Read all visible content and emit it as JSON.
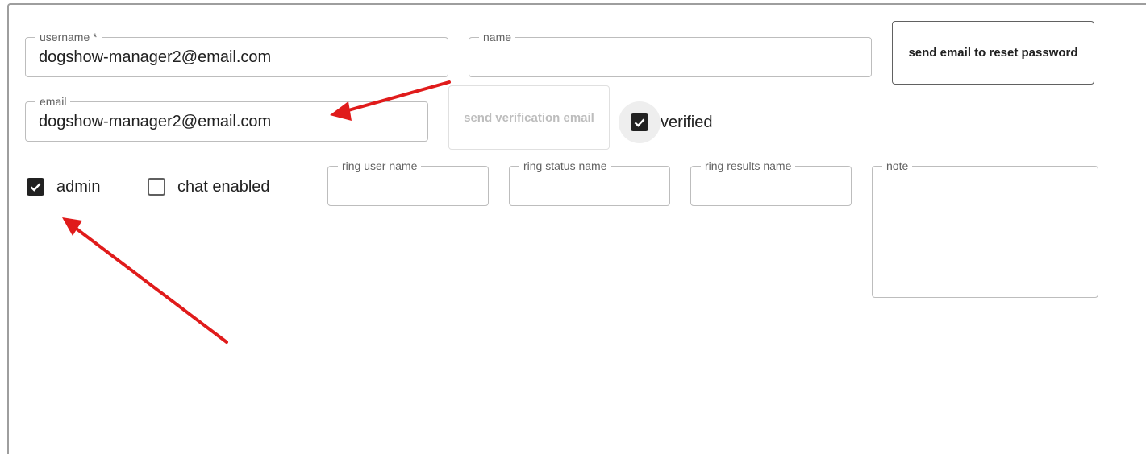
{
  "form": {
    "username": {
      "label": "username *",
      "value": "dogshow-manager2@email.com"
    },
    "name": {
      "label": "name",
      "value": ""
    },
    "email": {
      "label": "email",
      "value": "dogshow-manager2@email.com"
    },
    "ring_user_name": {
      "label": "ring user name",
      "value": ""
    },
    "ring_status_name": {
      "label": "ring status name",
      "value": ""
    },
    "ring_results_name": {
      "label": "ring results name",
      "value": ""
    },
    "note": {
      "label": "note",
      "value": ""
    }
  },
  "buttons": {
    "reset_password": "send email to reset password",
    "send_verification": "send verification email"
  },
  "checkboxes": {
    "verified": {
      "label": "verified",
      "checked": true
    },
    "admin": {
      "label": "admin",
      "checked": true
    },
    "chat_enabled": {
      "label": "chat enabled",
      "checked": false
    }
  },
  "annotations": {
    "arrow_color": "#e01b1b"
  }
}
